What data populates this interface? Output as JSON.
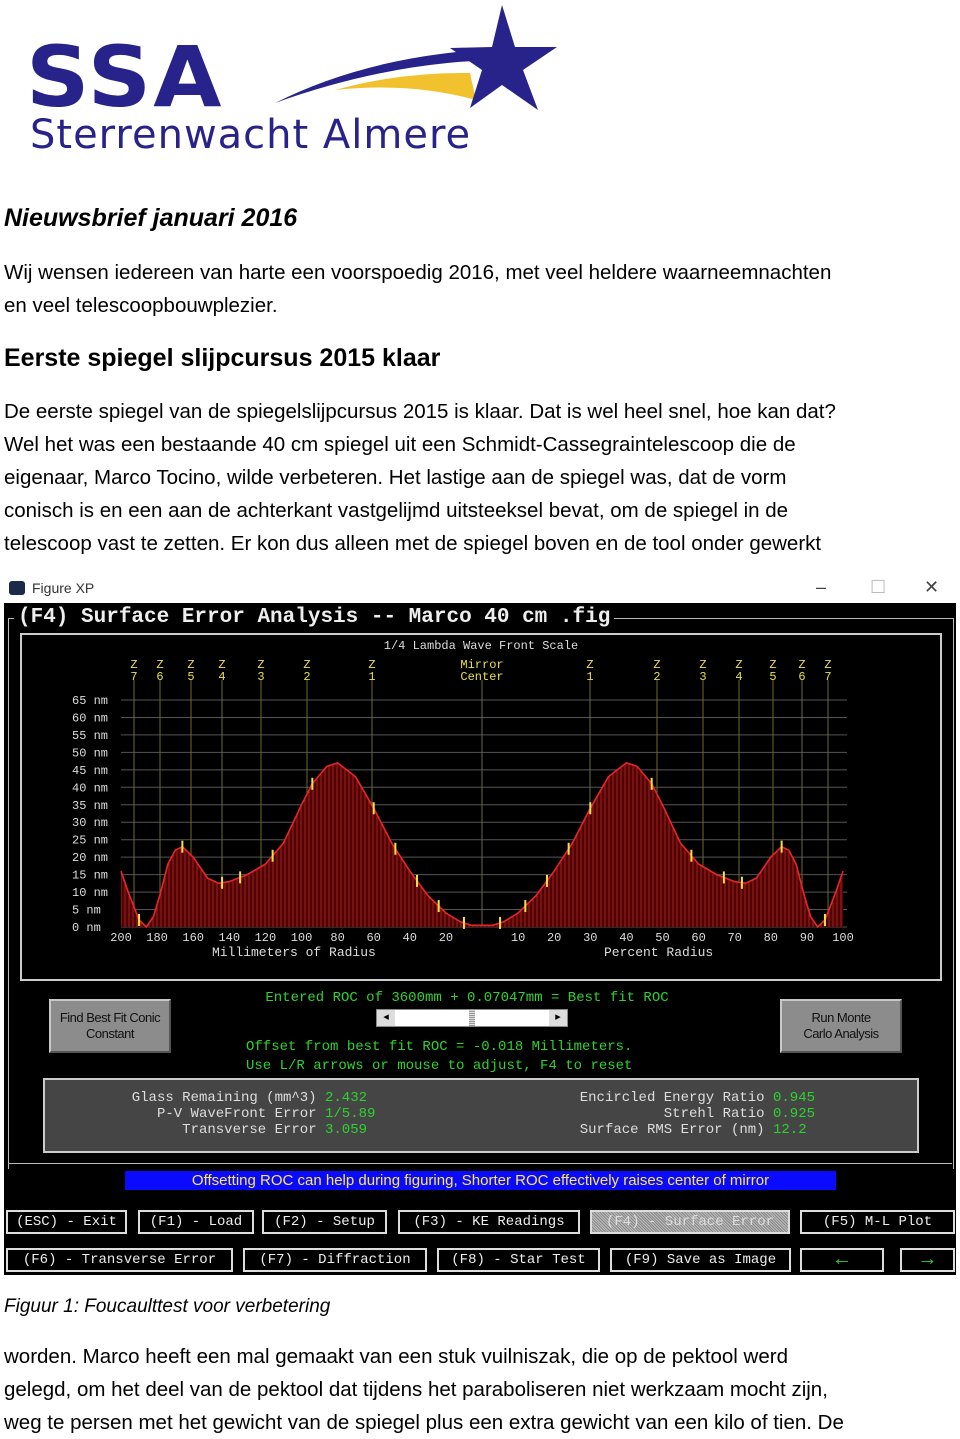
{
  "logo": {
    "acronym": "SSA",
    "name": "Sterrenwacht Almere",
    "colors": {
      "blue": "#27238a",
      "yellow": "#f2c12e"
    }
  },
  "newsletter_title": "Nieuwsbrief januari 2016",
  "intro_lines": [
    "Wij wensen iedereen van harte een voorspoedig 2016, met veel heldere waarneemnachten",
    "en veel telescoopbouwplezier."
  ],
  "section_title": "Eerste spiegel slijpcursus 2015 klaar",
  "section_lines": [
    "De eerste spiegel van de spiegelslijpcursus 2015 is klaar. Dat is wel heel snel, hoe kan dat?",
    "Wel het was een bestaande 40 cm spiegel uit een Schmidt-Cassegraintelescoop die de",
    "eigenaar, Marco Tocino, wilde verbeteren. Het lastige aan de spiegel was, dat de vorm",
    "conisch is en een aan de achterkant vastgelijmd uitsteeksel bevat, om de spiegel in de",
    "telescoop vast te zetten.  Er kon dus alleen met de spiegel boven en de tool onder gewerkt"
  ],
  "figure": {
    "window_title": "Figure XP",
    "window_controls": {
      "minimize": "–",
      "maximize": "☐",
      "close": "✕"
    },
    "frame_title": "(F4) Surface Error Analysis -- Marco 40 cm .fig",
    "scale_label": "1/4 Lambda Wave Front Scale",
    "zone_labels_left": [
      "Z 7",
      "Z 6",
      "Z 5",
      "Z 4",
      "Z 3",
      "Z 2",
      "Z 1"
    ],
    "mirror_center": [
      "Mirror",
      "Center"
    ],
    "zone_labels_right": [
      "Z 1",
      "Z 2",
      "Z 3",
      "Z 4",
      "Z 5",
      "Z 6",
      "Z 7"
    ],
    "roc_text": "Entered ROC of 3600mm + 0.07047mm = Best fit ROC",
    "offset_text": "Offset from best fit ROC = -0.018 Millimeters.",
    "adjust_text": "Use L/R arrows or mouse to adjust, F4 to reset",
    "slider_left": "◂",
    "slider_right": "▸",
    "find_conic_button": "Find Best Fit Conic Constant",
    "monte_carlo_button": "Run Monte Carlo Analysis",
    "stats_left": [
      {
        "label": "Glass Remaining (mm^3)",
        "value": "2.432"
      },
      {
        "label": "P-V WaveFront Error",
        "value": "1/5.89"
      },
      {
        "label": "Transverse Error",
        "value": "3.059"
      }
    ],
    "stats_right": [
      {
        "label": "Encircled Energy Ratio",
        "value": "0.945"
      },
      {
        "label": "Strehl Ratio",
        "value": "0.925"
      },
      {
        "label": "Surface RMS Error (nm)",
        "value": "12.2"
      }
    ],
    "tip": "Offsetting ROC can help during figuring, Shorter ROC effectively raises center of mirror",
    "buttons_row1": [
      "(ESC) - Exit",
      "(F1) - Load",
      "(F2) - Setup",
      "(F3) - KE Readings",
      "(F4) - Surface Error",
      "(F5) M-L Plot"
    ],
    "buttons_row2": [
      "(F6) - Transverse Error",
      "(F7) - Diffraction",
      "(F8) - Star Test",
      "(F9) Save as Image",
      "←",
      "→"
    ],
    "active_button": "(F4) - Surface Error"
  },
  "chart_data": {
    "type": "area",
    "symmetric": true,
    "xlabel_left": "Millimeters of Radius",
    "xlabel_right": "Percent Radius",
    "xticks_left": [
      "200",
      "180",
      "160",
      "140",
      "120",
      "100",
      "80",
      "60",
      "40",
      "20"
    ],
    "xticks_right": [
      "10",
      "20",
      "30",
      "40",
      "50",
      "60",
      "70",
      "80",
      "90",
      "100"
    ],
    "yticks": [
      "65 nm",
      "60 nm",
      "55 nm",
      "50 nm",
      "45 nm",
      "40 nm",
      "35 nm",
      "30 nm",
      "25 nm",
      "20 nm",
      "15 nm",
      "10 nm",
      "5 nm",
      "0 nm"
    ],
    "ylim": [
      0,
      65
    ],
    "xlim_percent": [
      0,
      100
    ],
    "grid": true,
    "colors": {
      "curve": "#e8262a",
      "fill": "#4a0606",
      "zone_marker": "#f5e04a",
      "grid": "#555"
    },
    "percent_radius": [
      0,
      3,
      6,
      10,
      15,
      20,
      25,
      30,
      35,
      40,
      43,
      47,
      50,
      55,
      60,
      65,
      70,
      73,
      76,
      80,
      83,
      85,
      87,
      89,
      91,
      93,
      95,
      98,
      100
    ],
    "surface_nm": [
      0.5,
      0.5,
      1.5,
      4,
      9,
      16,
      24,
      34,
      43,
      47,
      46,
      41,
      35,
      24,
      18,
      15,
      13,
      12.5,
      14,
      20,
      23,
      22,
      18,
      10,
      3,
      0,
      2,
      10,
      16
    ],
    "zone_percent": [
      5,
      12,
      18,
      24,
      30,
      47,
      58,
      67,
      72,
      83,
      95
    ]
  },
  "caption": "Figuur 1: Foucaulttest voor verbetering",
  "closing_lines": [
    "worden. Marco heeft een mal gemaakt van een stuk vuilniszak, die op de pektool werd",
    "gelegd, om het deel van de pektool dat tijdens het paraboliseren niet werkzaam mocht zijn,",
    "weg te persen met het gewicht van de spiegel plus een extra gewicht van een kilo of tien. De"
  ]
}
